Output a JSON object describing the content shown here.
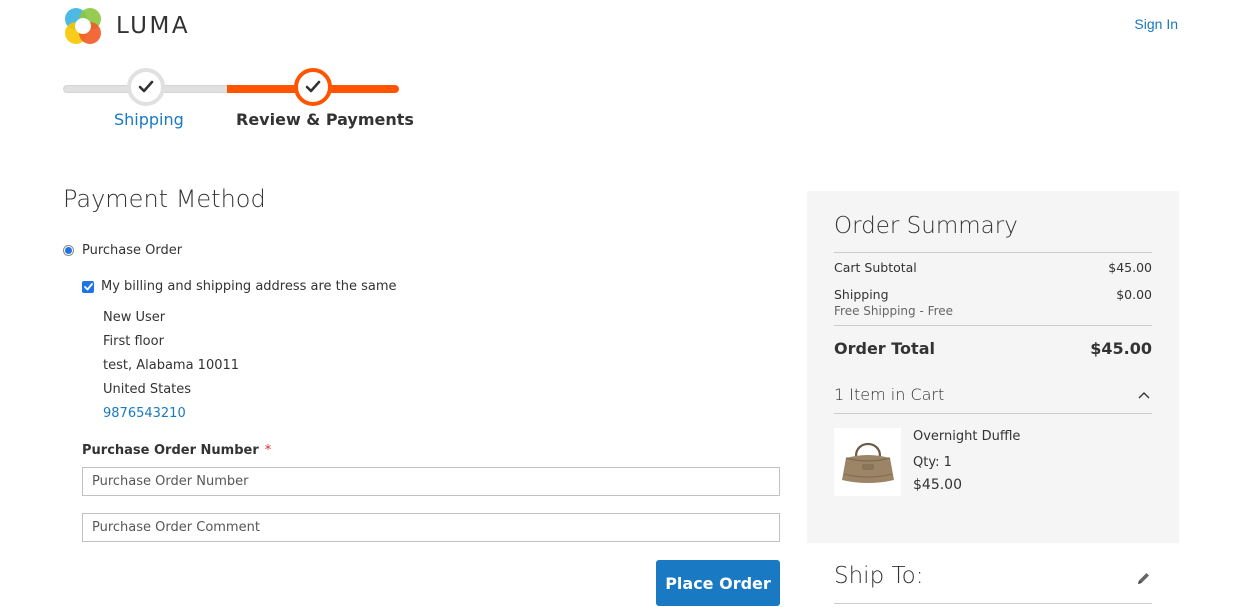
{
  "header": {
    "logo_text": "LUMA",
    "signin_label": "Sign In"
  },
  "progress": {
    "steps": [
      {
        "label": "Shipping",
        "state": "complete"
      },
      {
        "label": "Review & Payments",
        "state": "active"
      }
    ]
  },
  "payment": {
    "title": "Payment Method",
    "method_label": "Purchase Order",
    "same_address_label": "My billing and shipping address are the same",
    "address": {
      "name": "New User",
      "street": "First floor",
      "city_region_zip": "test, Alabama 10011",
      "country": "United States",
      "phone": "9876543210"
    },
    "po_number_label": "Purchase Order Number",
    "required_marker": "*",
    "po_number_placeholder": "Purchase Order Number",
    "po_comment_placeholder": "Purchase Order Comment",
    "place_order_label": "Place Order"
  },
  "summary": {
    "title": "Order Summary",
    "cart_subtotal_label": "Cart Subtotal",
    "cart_subtotal_value": "$45.00",
    "shipping_label": "Shipping",
    "shipping_value": "$0.00",
    "shipping_method": "Free Shipping - Free",
    "order_total_label": "Order Total",
    "order_total_value": "$45.00",
    "items_label": "1 Item in Cart",
    "item": {
      "name": "Overnight Duffle",
      "qty": "Qty: 1",
      "price": "$45.00"
    }
  },
  "ship_to": {
    "title": "Ship To:"
  },
  "colors": {
    "accent_orange": "#ff5501",
    "link_blue": "#1979c3",
    "summary_bg": "#f5f5f5"
  }
}
